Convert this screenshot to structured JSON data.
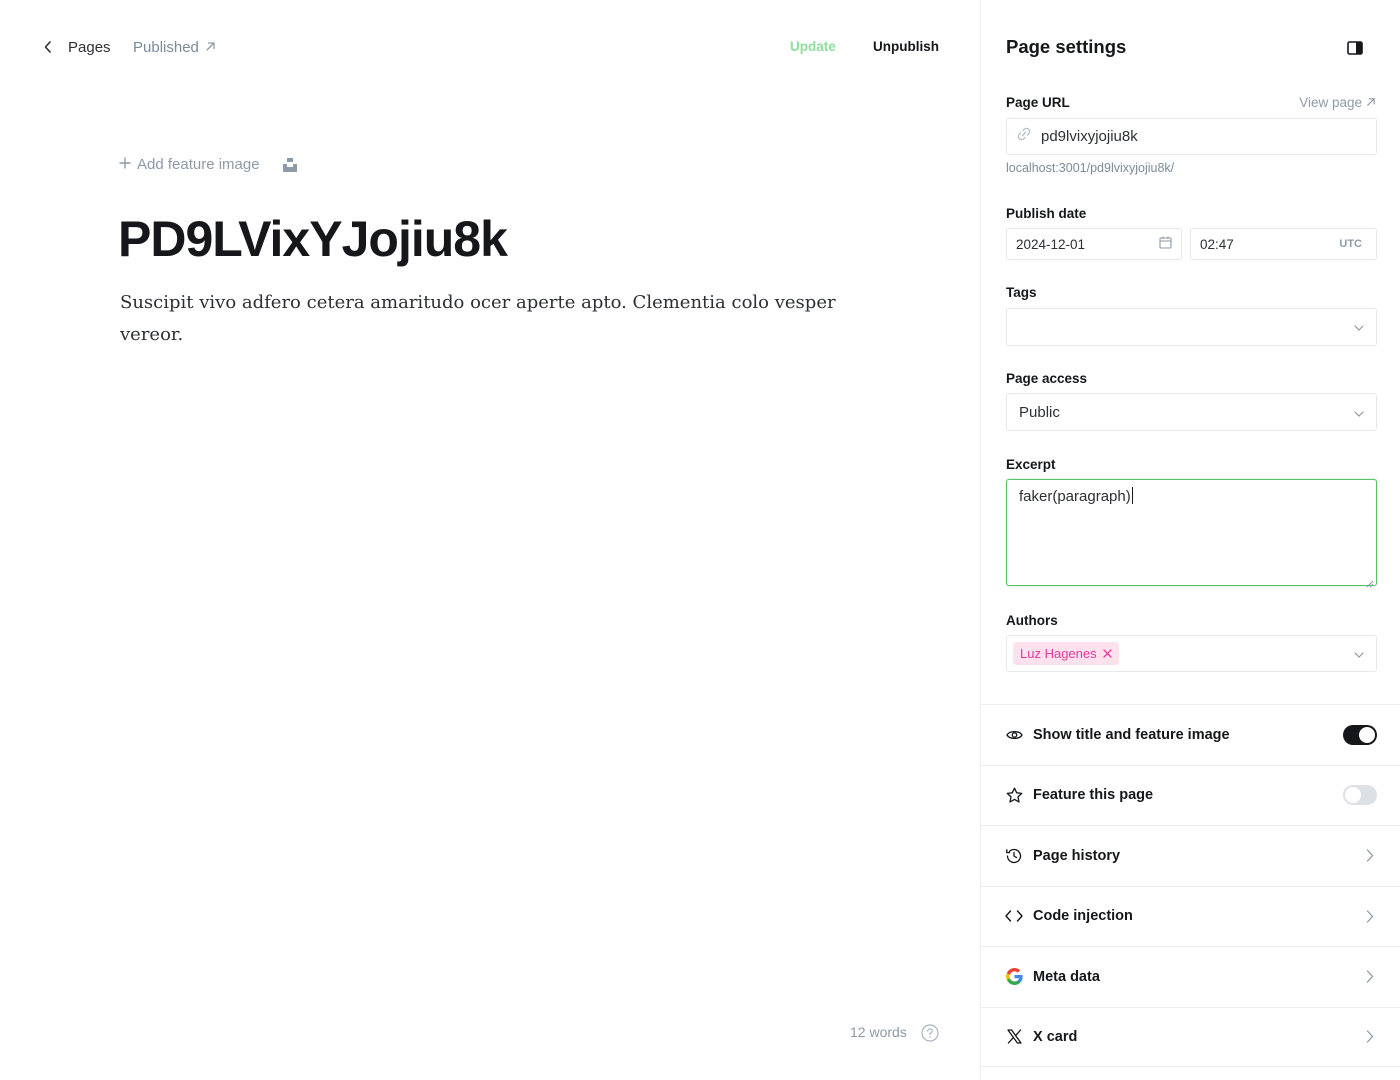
{
  "topbar": {
    "back_label": "Pages",
    "status_label": "Published",
    "update_label": "Update",
    "unpublish_label": "Unpublish"
  },
  "editor": {
    "add_feature_label": "Add feature image",
    "title": "PD9LVixYJojiu8k",
    "body": "Suscipit vivo adfero cetera amaritudo ocer aperte apto. Clementia colo vesper vereor.",
    "word_count": "12 words"
  },
  "settings": {
    "title": "Page settings",
    "url": {
      "label": "Page URL",
      "view_page_label": "View page",
      "value": "pd9lvixyjojiu8k",
      "hint": "localhost:3001/pd9lvixyjojiu8k/"
    },
    "publish_date": {
      "label": "Publish date",
      "date": "2024-12-01",
      "time": "02:47",
      "timezone": "UTC"
    },
    "tags": {
      "label": "Tags",
      "value": ""
    },
    "access": {
      "label": "Page access",
      "value": "Public"
    },
    "excerpt": {
      "label": "Excerpt",
      "value": "faker(paragraph)"
    },
    "authors": {
      "label": "Authors",
      "chips": [
        "Luz Hagenes"
      ]
    },
    "menu": [
      {
        "label": "Show title and feature image",
        "icon": "eye-icon",
        "control": "toggle",
        "on": true
      },
      {
        "label": "Feature this page",
        "icon": "star-icon",
        "control": "toggle",
        "on": false
      },
      {
        "label": "Page history",
        "icon": "history-icon",
        "control": "chevron"
      },
      {
        "label": "Code injection",
        "icon": "code-icon",
        "control": "chevron"
      },
      {
        "label": "Meta data",
        "icon": "google-icon",
        "control": "chevron"
      },
      {
        "label": "X card",
        "icon": "x-logo-icon",
        "control": "chevron"
      }
    ]
  },
  "colors": {
    "accent_green": "#5ac167",
    "update_green": "#8fdc9c",
    "author_pink": "#e5399a",
    "author_pink_bg": "#fde2ee"
  }
}
